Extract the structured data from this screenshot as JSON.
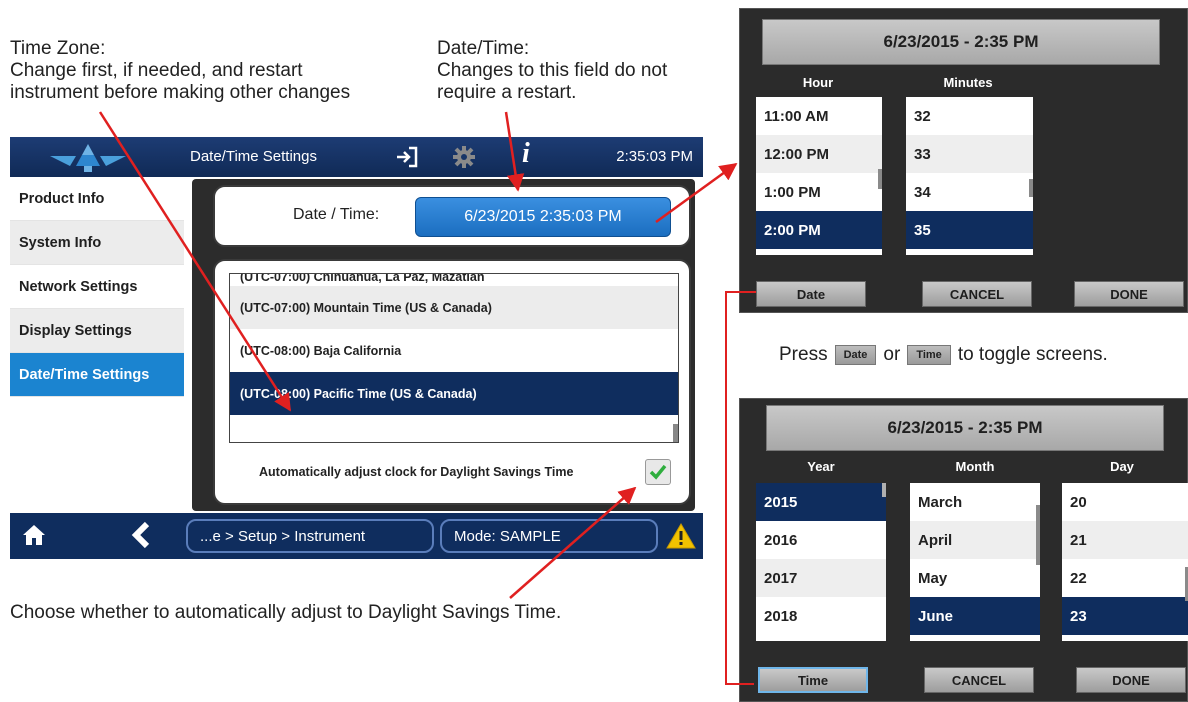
{
  "callouts": {
    "timezone": {
      "line1": "Time Zone:",
      "line2": "Change first, if needed, and restart",
      "line3": "instrument before making other changes"
    },
    "datetime": {
      "line1": "Date/Time:",
      "line2": "Changes to this field do not",
      "line3": "require a restart."
    },
    "dst": "Choose whether to automatically adjust to Daylight Savings Time.",
    "press": {
      "before": "Press",
      "date_btn": "Date",
      "or": "or",
      "time_btn": "Time",
      "after": "to toggle screens."
    }
  },
  "main": {
    "title": "Date/Time Settings",
    "clock": "2:35:03 PM",
    "sidebar": [
      {
        "label": "Product Info"
      },
      {
        "label": "System Info"
      },
      {
        "label": "Network Settings"
      },
      {
        "label": "Display Settings"
      },
      {
        "label": "Date/Time Settings",
        "active": true
      }
    ],
    "datetime_label": "Date / Time:",
    "datetime_value": "6/23/2015 2:35:03 PM",
    "timezones": [
      "(UTC-07:00) Chihuahua, La Paz, Mazatlan",
      "(UTC-07:00) Mountain Time (US & Canada)",
      "(UTC-08:00) Baja California",
      "(UTC-08:00) Pacific Time (US & Canada)"
    ],
    "selected_timezone_index": 3,
    "dst_label": "Automatically adjust clock for Daylight Savings Time",
    "dst_checked": true,
    "breadcrumb": "...e > Setup > Instrument",
    "mode": "Mode: SAMPLE"
  },
  "time_picker": {
    "header": "6/23/2015 - 2:35 PM",
    "hour_label": "Hour",
    "minutes_label": "Minutes",
    "hours": [
      "11:00 AM",
      "12:00 PM",
      "1:00 PM",
      "2:00 PM"
    ],
    "minutes": [
      "32",
      "33",
      "34",
      "35"
    ],
    "buttons": {
      "toggle": "Date",
      "cancel": "CANCEL",
      "done": "DONE"
    }
  },
  "date_picker": {
    "header": "6/23/2015 - 2:35 PM",
    "year_label": "Year",
    "month_label": "Month",
    "day_label": "Day",
    "years": [
      "2015",
      "2016",
      "2017",
      "2018"
    ],
    "months": [
      "March",
      "April",
      "May",
      "June"
    ],
    "days": [
      "20",
      "21",
      "22",
      "23"
    ],
    "buttons": {
      "toggle": "Time",
      "cancel": "CANCEL",
      "done": "DONE"
    }
  },
  "colors": {
    "nav": "#0f2d5e",
    "accent": "#1b84d0",
    "arrow": "#e02020"
  }
}
